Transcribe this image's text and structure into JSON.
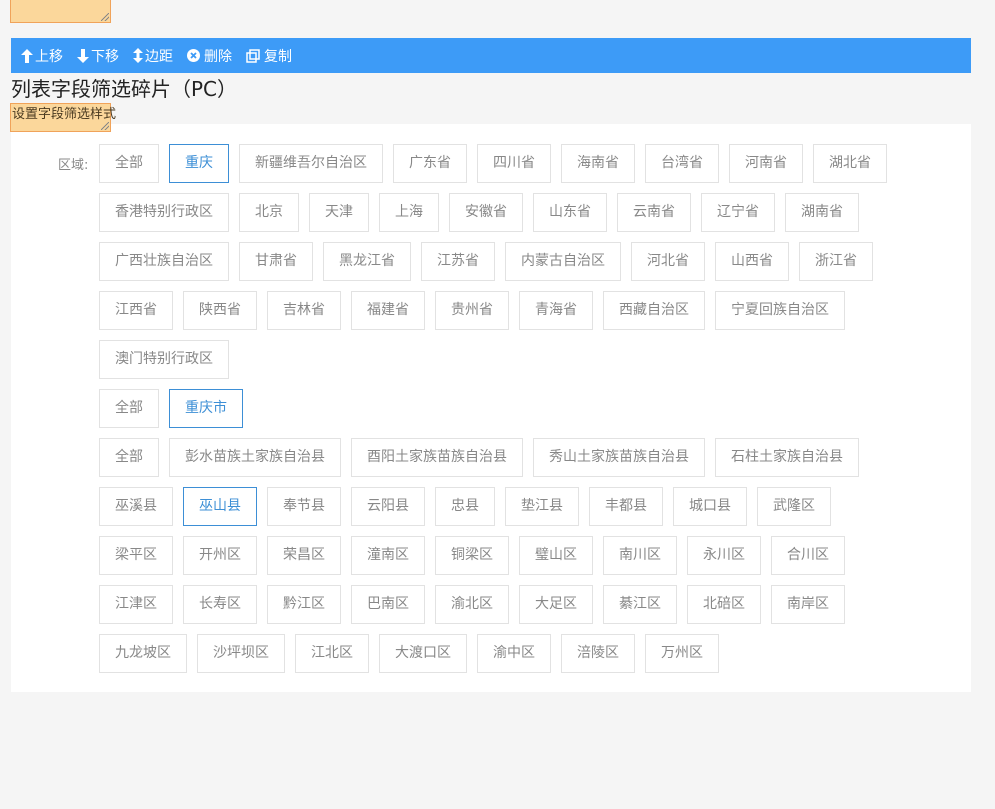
{
  "toolbar": {
    "items": [
      {
        "label": "上移",
        "icon": "arrow-up-icon"
      },
      {
        "label": "下移",
        "icon": "arrow-down-icon"
      },
      {
        "label": "边距",
        "icon": "arrow-up-down-icon"
      },
      {
        "label": "删除",
        "icon": "close-circle-icon"
      },
      {
        "label": "复制",
        "icon": "copy-icon"
      }
    ],
    "background": "#3d9bf7"
  },
  "title": "列表字段筛选碎片（PC）",
  "style_label": "设置字段筛选样式",
  "filter": {
    "label": "区域:",
    "accent": "#3d8fd6",
    "provinces": [
      "全部",
      "重庆",
      "新疆维吾尔自治区",
      "广东省",
      "四川省",
      "海南省",
      "台湾省",
      "河南省",
      "湖北省",
      "香港特别行政区",
      "北京",
      "天津",
      "上海",
      "安徽省",
      "山东省",
      "云南省",
      "辽宁省",
      "湖南省",
      "广西壮族自治区",
      "甘肃省",
      "黑龙江省",
      "江苏省",
      "内蒙古自治区",
      "河北省",
      "山西省",
      "浙江省",
      "江西省",
      "陕西省",
      "吉林省",
      "福建省",
      "贵州省",
      "青海省",
      "西藏自治区",
      "宁夏回族自治区",
      "澳门特别行政区"
    ],
    "provinces_selected": "重庆",
    "cities": [
      "全部",
      "重庆市"
    ],
    "cities_selected": "重庆市",
    "counties": [
      "全部",
      "彭水苗族土家族自治县",
      "酉阳土家族苗族自治县",
      "秀山土家族苗族自治县",
      "石柱土家族自治县",
      "巫溪县",
      "巫山县",
      "奉节县",
      "云阳县",
      "忠县",
      "垫江县",
      "丰都县",
      "城口县",
      "武隆区",
      "梁平区",
      "开州区",
      "荣昌区",
      "潼南区",
      "铜梁区",
      "璧山区",
      "南川区",
      "永川区",
      "合川区",
      "江津区",
      "长寿区",
      "黔江区",
      "巴南区",
      "渝北区",
      "大足区",
      "綦江区",
      "北碚区",
      "南岸区",
      "九龙坡区",
      "沙坪坝区",
      "江北区",
      "大渡口区",
      "渝中区",
      "涪陵区",
      "万州区"
    ],
    "counties_selected": "巫山县"
  }
}
